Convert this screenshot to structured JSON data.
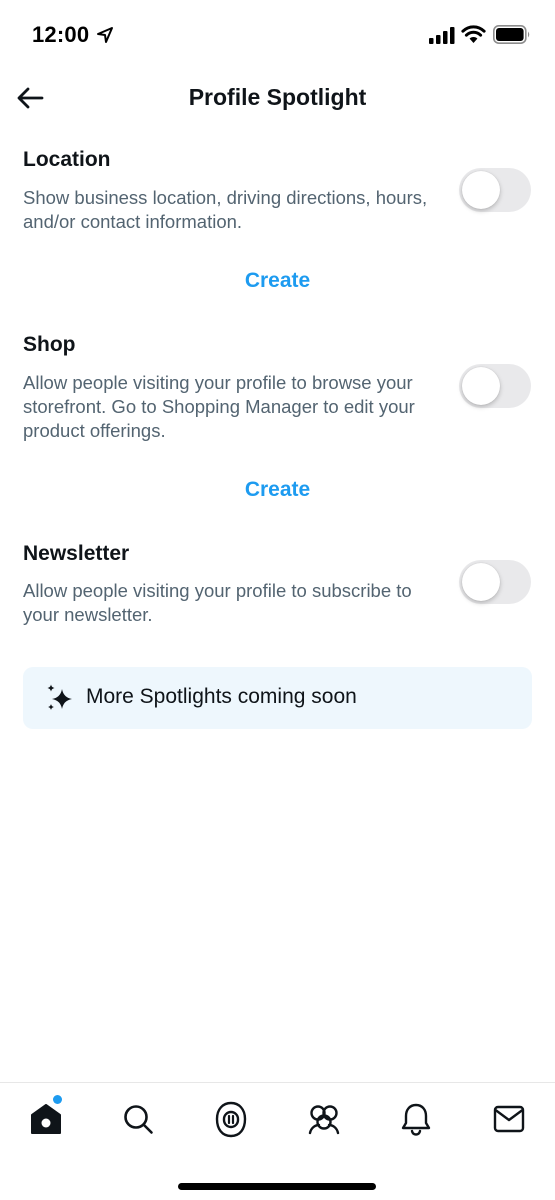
{
  "status_bar": {
    "time": "12:00",
    "icons": [
      "location-arrow-icon",
      "cellular-signal-icon",
      "wifi-icon",
      "battery-icon"
    ]
  },
  "header": {
    "title": "Profile Spotlight",
    "back_icon": "back-arrow-icon"
  },
  "sections": [
    {
      "title": "Location",
      "description": "Show business location, driving directions, hours, and/or contact information.",
      "toggle_on": false,
      "action_label": "Create"
    },
    {
      "title": "Shop",
      "description": "Allow people visiting your profile to browse your storefront. Go to Shopping Manager to edit your product offerings.",
      "toggle_on": false,
      "action_label": "Create"
    },
    {
      "title": "Newsletter",
      "description": "Allow people visiting your profile to subscribe to your newsletter.",
      "toggle_on": false
    }
  ],
  "coming_soon": {
    "text": "More Spotlights coming soon",
    "icon": "sparkle-icon"
  },
  "tab_bar": {
    "tabs": [
      "home-icon",
      "search-icon",
      "spaces-icon",
      "communities-icon",
      "notifications-icon",
      "messages-icon"
    ],
    "active": "home-icon",
    "home_has_badge": true
  },
  "colors": {
    "accent": "#1d9bf0",
    "text_primary": "#0f1419",
    "text_secondary": "#536471",
    "toggle_off": "#e9e9eb",
    "banner_bg": "#eef7fd"
  }
}
